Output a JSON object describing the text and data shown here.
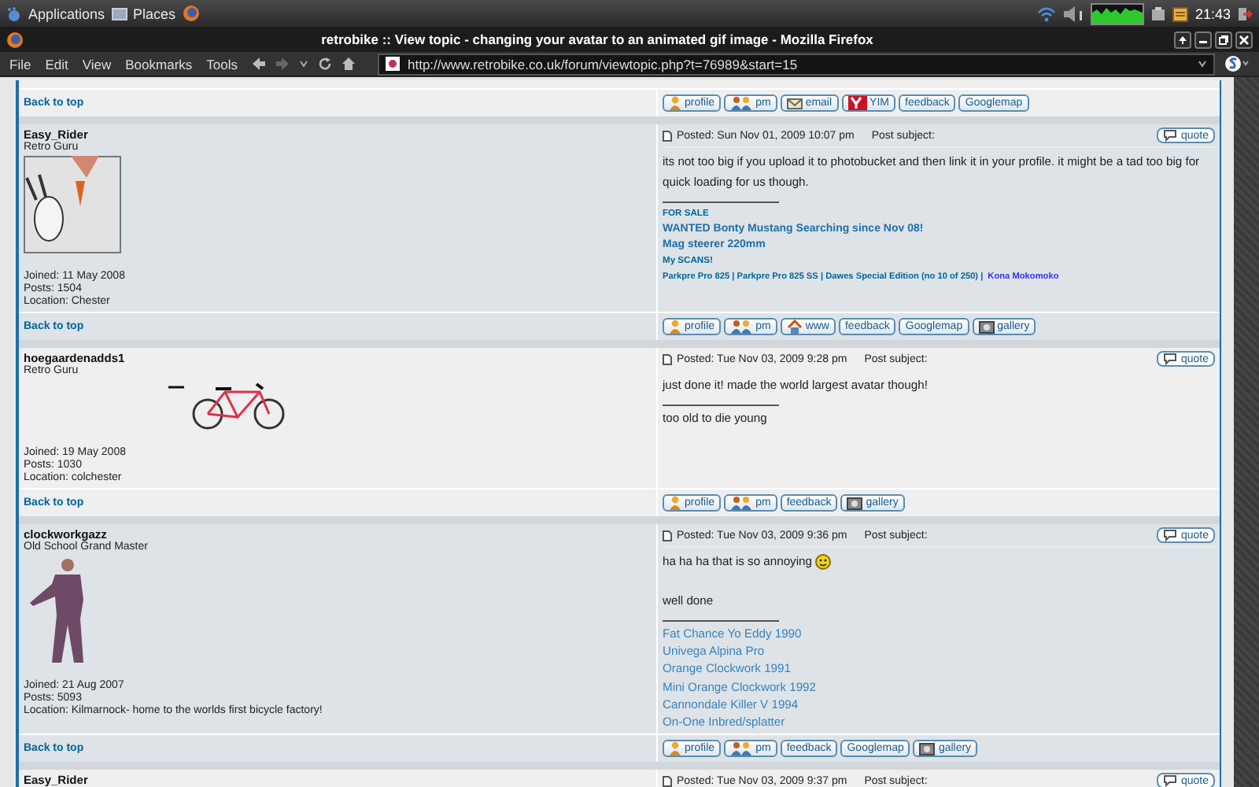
{
  "top_panel": {
    "menus": [
      "Applications",
      "Places"
    ],
    "clock": "21:43"
  },
  "window": {
    "title": "retrobike :: View topic - changing your avatar to an animated gif image - Mozilla Firefox"
  },
  "menu_bar": [
    "File",
    "Edit",
    "View",
    "Bookmarks",
    "Tools"
  ],
  "address_bar": {
    "value": "http://www.retrobike.co.uk/forum/viewtopic.php?t=76989&start=15"
  },
  "posts": [
    {
      "footer": {
        "back_to_top": "Back to top",
        "buttons": [
          {
            "kind": "profile",
            "label": "profile"
          },
          {
            "kind": "pm",
            "label": "pm"
          },
          {
            "kind": "email",
            "label": "email"
          },
          {
            "kind": "yim",
            "label": "YIM"
          },
          {
            "kind": "plain",
            "label": "feedback"
          },
          {
            "kind": "plain",
            "label": "Googlemap"
          }
        ]
      }
    },
    {
      "profile": {
        "name": "Easy_Rider",
        "rank": "Retro Guru",
        "avatar": {
          "kind": "cartoon"
        },
        "details": [
          "Joined: 11 May 2008",
          "Posts: 1504",
          "Location: Chester"
        ]
      },
      "header": {
        "posted": "Posted: Sun Nov 01, 2009 10:07 pm",
        "subject": "Post subject:",
        "quote": "quote"
      },
      "body": [
        {
          "text": "its not too big if you upload it to photobucket and then link it in your profile. it might be a tad too big for quick loading for us though.",
          "smiley": false
        }
      ],
      "signature": [
        {
          "kind": "small-heading",
          "text": "FOR SALE"
        },
        {
          "kind": "bold-link",
          "text": "WANTED Bonty Mustang Searching since Nov 08!"
        },
        {
          "kind": "bold-link",
          "text": "Mag steerer 220mm"
        },
        {
          "kind": "small-heading",
          "text": "My SCANS!"
        },
        {
          "kind": "parts",
          "parts": [
            {
              "text": "Parkpre Pro 825 | Parkpre Pro 825 SS | Dawes Special Edition (no 10 of 250) |",
              "color": "#006699"
            },
            {
              "text": "Kona Mokomoko",
              "color": "#3333ee"
            }
          ]
        }
      ],
      "footer": {
        "back_to_top": "Back to top",
        "buttons": [
          {
            "kind": "profile",
            "label": "profile"
          },
          {
            "kind": "pm",
            "label": "pm"
          },
          {
            "kind": "www",
            "label": "www"
          },
          {
            "kind": "plain",
            "label": "feedback"
          },
          {
            "kind": "plain",
            "label": "Googlemap"
          },
          {
            "kind": "gallery",
            "label": "gallery"
          }
        ]
      }
    },
    {
      "profile": {
        "name": "hoegaardenadds1",
        "rank": "Retro Guru",
        "avatar": {
          "kind": "bicycle"
        },
        "details": [
          "Joined: 19 May 2008",
          "Posts: 1030",
          "Location: colchester"
        ]
      },
      "header": {
        "posted": "Posted: Tue Nov 03, 2009 9:28 pm",
        "subject": "Post subject:",
        "quote": "quote"
      },
      "body": [
        {
          "text": "just done it! made the world largest avatar though!",
          "smiley": false
        }
      ],
      "signature": [
        {
          "kind": "text",
          "text": "too old to die young"
        }
      ],
      "footer": {
        "back_to_top": "Back to top",
        "buttons": [
          {
            "kind": "profile",
            "label": "profile"
          },
          {
            "kind": "pm",
            "label": "pm"
          },
          {
            "kind": "plain",
            "label": "feedback"
          },
          {
            "kind": "gallery",
            "label": "gallery"
          }
        ]
      }
    },
    {
      "profile": {
        "name": "clockworkgazz",
        "rank": "Old School Grand Master",
        "avatar": {
          "kind": "person"
        },
        "details": [
          "Joined: 21 Aug 2007",
          "Posts: 5093",
          "Location: Kilmarnock- home to the worlds first bicycle factory!"
        ]
      },
      "header": {
        "posted": "Posted: Tue Nov 03, 2009 9:36 pm",
        "subject": "Post subject:",
        "quote": "quote"
      },
      "body": [
        {
          "text": "ha ha ha that is so annoying",
          "smiley": true
        },
        {
          "text": "well done",
          "smiley": false
        }
      ],
      "signature": [
        {
          "kind": "link",
          "text": "Fat Chance Yo Eddy 1990"
        },
        {
          "kind": "link",
          "text": "Univega Alpina Pro"
        },
        {
          "kind": "link",
          "text": "Orange Clockwork 1991"
        },
        {
          "kind": "link",
          "text": "Mini Orange Clockwork 1992"
        },
        {
          "kind": "link",
          "text": "Cannondale Killer V 1994"
        },
        {
          "kind": "link",
          "text": "On-One Inbred/splatter"
        }
      ],
      "footer": {
        "back_to_top": "Back to top",
        "buttons": [
          {
            "kind": "profile",
            "label": "profile"
          },
          {
            "kind": "pm",
            "label": "pm"
          },
          {
            "kind": "plain",
            "label": "feedback"
          },
          {
            "kind": "plain",
            "label": "Googlemap"
          },
          {
            "kind": "gallery",
            "label": "gallery"
          }
        ]
      }
    },
    {
      "profile": {
        "name": "Easy_Rider"
      },
      "header": {
        "posted": "Posted: Tue Nov 03, 2009 9:37 pm",
        "subject": "Post subject:",
        "quote": "quote"
      }
    }
  ]
}
